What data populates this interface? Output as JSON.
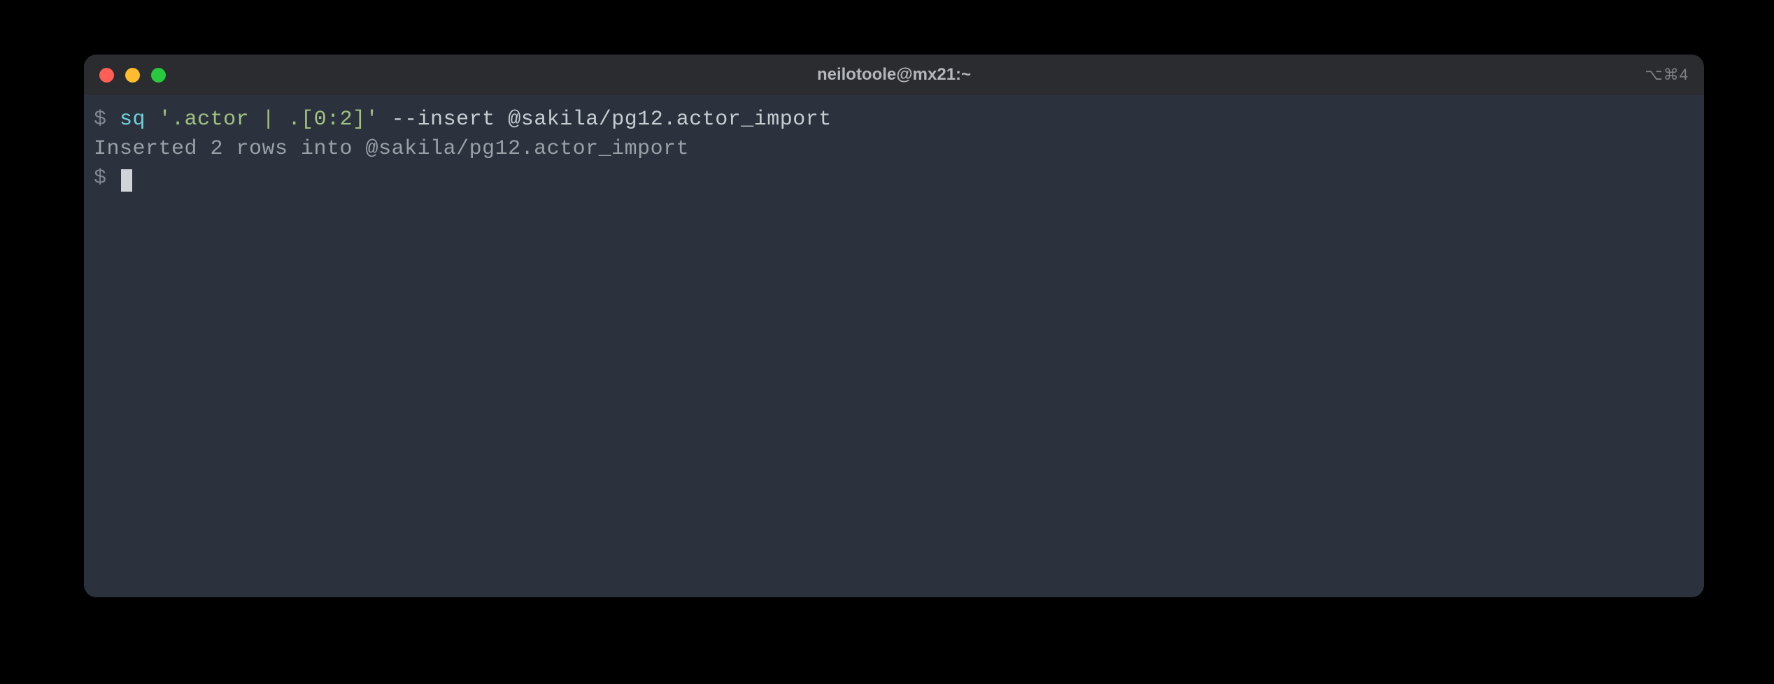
{
  "window": {
    "title": "neilotoole@mx21:~",
    "shortcut_hint": "⌥⌘4"
  },
  "terminal": {
    "prompt": "$",
    "lines": [
      {
        "type": "command",
        "parts": {
          "cmd": "sq",
          "quoted": "'.actor | .[0:2]'",
          "flag": "--insert",
          "target": "@sakila/pg12.actor_import"
        }
      },
      {
        "type": "output",
        "text": "Inserted 2 rows into @sakila/pg12.actor_import"
      },
      {
        "type": "prompt_only"
      }
    ]
  }
}
